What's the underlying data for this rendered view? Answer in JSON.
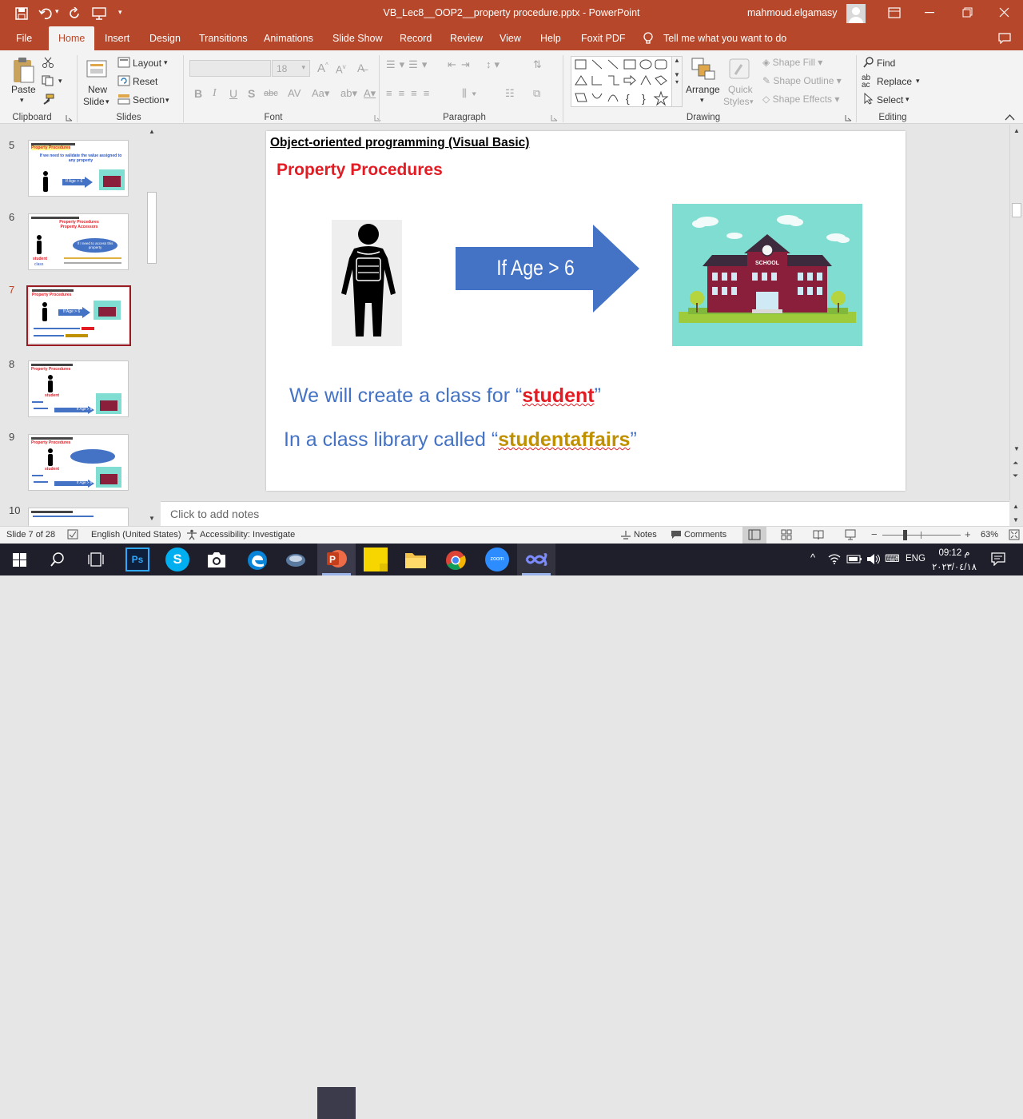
{
  "window": {
    "title": "VB_Lec8__OOP2__property procedure.pptx  -  PowerPoint",
    "user": "mahmoud.elgamasy"
  },
  "tabs": [
    "File",
    "Home",
    "Insert",
    "Design",
    "Transitions",
    "Animations",
    "Slide Show",
    "Record",
    "Review",
    "View",
    "Help",
    "Foxit PDF"
  ],
  "tell_me": "Tell me what you want to do",
  "ribbon": {
    "clipboard": {
      "paste": "Paste",
      "label": "Clipboard"
    },
    "slides": {
      "new_slide_1": "New",
      "new_slide_2": "Slide",
      "layout": "Layout",
      "reset": "Reset",
      "section": "Section",
      "label": "Slides"
    },
    "font": {
      "size": "18",
      "label": "Font"
    },
    "paragraph": {
      "label": "Paragraph"
    },
    "drawing": {
      "arrange": "Arrange",
      "quick_styles_1": "Quick",
      "quick_styles_2": "Styles",
      "shape_fill": "Shape Fill",
      "shape_outline": "Shape Outline",
      "shape_effects": "Shape Effects",
      "label": "Drawing"
    },
    "editing": {
      "find": "Find",
      "replace": "Replace",
      "select": "Select",
      "label": "Editing"
    }
  },
  "thumbnails": [
    {
      "num": "5",
      "title": "Property Procedures",
      "text": "If we need to validate the value assigned to any property",
      "arrow": "If Age > 6"
    },
    {
      "num": "6",
      "title": "Property Procedures",
      "subtitle": "Property Accessors",
      "text": "If I need to access this property",
      "label": "student",
      "label2": "class"
    },
    {
      "num": "7",
      "title": "Property Procedures",
      "arrow": "If Age > 6"
    },
    {
      "num": "8",
      "title": "Property Procedures",
      "label": "student",
      "arrow": "If Age > 6"
    },
    {
      "num": "9",
      "title": "Property Procedures",
      "label": "student",
      "arrow": "If Age > 6"
    },
    {
      "num": "10",
      "title": ""
    }
  ],
  "slide": {
    "header": "Object-oriented programming (Visual Basic)",
    "title": "Property Procedures",
    "arrow_text": "If Age > 6",
    "school_sign": "SCHOOL",
    "line1_pre": "We will create a class for “",
    "line1_key": "student",
    "line1_post": "”",
    "line2_pre": "In a class library called “",
    "line2_key": "studentaffairs",
    "line2_post": "”"
  },
  "notes_placeholder": "Click to add notes",
  "status": {
    "slide": "Slide 7 of 28",
    "language": "English (United States)",
    "accessibility": "Accessibility: Investigate",
    "notes": "Notes",
    "comments": "Comments",
    "zoom": "63%"
  },
  "taskbar": {
    "time": "09:12 م",
    "date": "٢٠٢٣/٠٤/١٨",
    "lang": "ENG"
  },
  "colors": {
    "accent": "#b7472a",
    "slide_title": "#e31b23",
    "slide_body": "#4472c4",
    "arrow": "#4472c4",
    "key_gold": "#bf9000"
  }
}
